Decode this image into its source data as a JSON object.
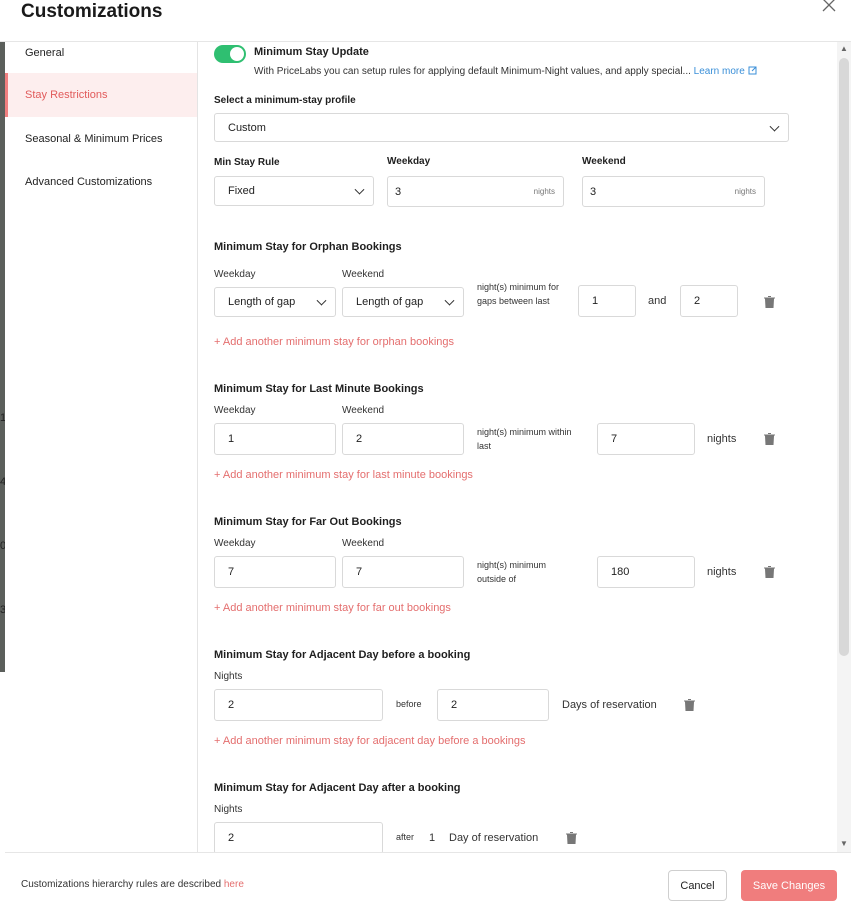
{
  "modal": {
    "title": "Customizations"
  },
  "left_strip": {
    "numbers": [
      "1",
      "4",
      "0",
      "3"
    ]
  },
  "sidebar": {
    "items": [
      {
        "label": "General"
      },
      {
        "label": "Stay Restrictions"
      },
      {
        "label": "Seasonal & Minimum Prices"
      },
      {
        "label": "Advanced Customizations"
      }
    ]
  },
  "min_stay_update": {
    "title": "Minimum Stay Update",
    "description": "With PriceLabs you can setup rules for applying default Minimum-Night values, and apply special...",
    "learn_more": "Learn more",
    "enabled": true
  },
  "profile": {
    "label": "Select a minimum-stay profile",
    "value": "Custom"
  },
  "min_stay_rule": {
    "rule_label": "Min Stay Rule",
    "rule_value": "Fixed",
    "weekday_label": "Weekday",
    "weekday_value": "3",
    "weekday_suffix": "nights",
    "weekend_label": "Weekend",
    "weekend_value": "3",
    "weekend_suffix": "nights"
  },
  "orphan": {
    "title": "Minimum Stay for Orphan Bookings",
    "weekday_label": "Weekday",
    "weekday_value": "Length of gap",
    "weekend_label": "Weekend",
    "weekend_value": "Length of gap",
    "desc": "night(s) minimum for gaps between last",
    "from_value": "1",
    "and_label": "and",
    "to_value": "2",
    "add_link": "+ Add another minimum stay for orphan bookings"
  },
  "last_minute": {
    "title": "Minimum Stay for Last Minute Bookings",
    "weekday_label": "Weekday",
    "weekday_value": "1",
    "weekend_label": "Weekend",
    "weekend_value": "2",
    "desc": "night(s) minimum within last",
    "days_value": "7",
    "unit": "nights",
    "add_link": "+ Add another minimum stay for last minute bookings"
  },
  "far_out": {
    "title": "Minimum Stay for Far Out Bookings",
    "weekday_label": "Weekday",
    "weekday_value": "7",
    "weekend_label": "Weekend",
    "weekend_value": "7",
    "desc": "night(s) minimum outside of",
    "days_value": "180",
    "unit": "nights",
    "add_link": "+ Add another minimum stay for far out bookings"
  },
  "adjacent_before": {
    "title": "Minimum Stay for Adjacent Day before a booking",
    "nights_label": "Nights",
    "nights_value": "2",
    "before_label": "before",
    "days_value": "2",
    "unit": "Days of reservation",
    "add_link": "+ Add another minimum stay for adjacent day before a bookings"
  },
  "adjacent_after": {
    "title": "Minimum Stay for Adjacent Day after a booking",
    "nights_label": "Nights",
    "nights_value": "2",
    "after_label": "after",
    "days_value": "1",
    "unit": "Day of reservation"
  },
  "footer": {
    "text": "Customizations hierarchy rules are described",
    "here": "here",
    "cancel": "Cancel",
    "save": "Save Changes"
  },
  "colors": {
    "accent": "#f07d7d",
    "toggle_on": "#2fbf71",
    "link": "#3a8fd8"
  }
}
